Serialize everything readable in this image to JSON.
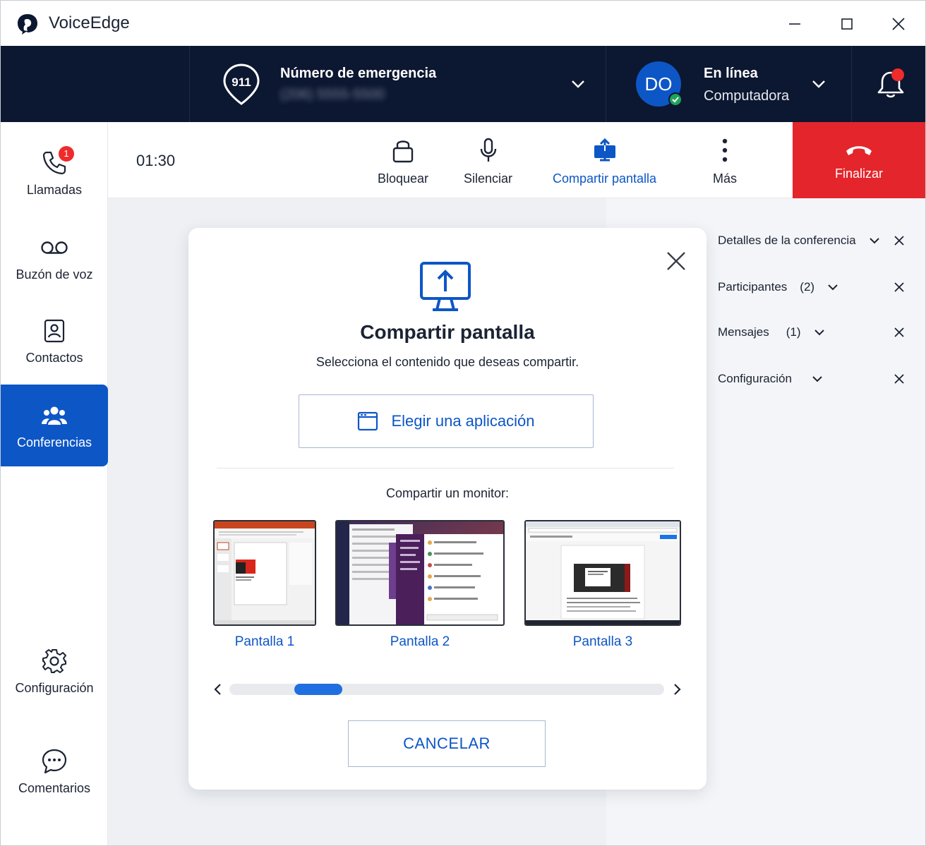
{
  "app": {
    "title": "VoiceEdge",
    "window_controls": [
      "minimize-icon",
      "maximize-icon",
      "close-icon"
    ]
  },
  "header": {
    "emergency": {
      "badge": "911",
      "title": "Número de emergencia",
      "number": "(206) 5555-5500"
    },
    "presence": {
      "initials": "DO",
      "status": "En línea",
      "device": "Computadora"
    },
    "notifications": {
      "has_unread": true
    }
  },
  "sidebar": {
    "items": [
      {
        "label": "Llamadas",
        "icon": "phone-icon",
        "badge": "1"
      },
      {
        "label": "Buzón de voz",
        "icon": "voicemail-icon"
      },
      {
        "label": "Contactos",
        "icon": "contact-card-icon"
      },
      {
        "label": "Conferencias",
        "icon": "group-icon",
        "active": true
      },
      {
        "label": "Configuración",
        "icon": "gear-icon"
      },
      {
        "label": "Comentarios",
        "icon": "chat-bubble-icon"
      }
    ]
  },
  "toolbar": {
    "timer": "01:30",
    "actions": [
      {
        "label": "Bloquear",
        "icon": "lock-icon"
      },
      {
        "label": "Silenciar",
        "icon": "microphone-icon"
      },
      {
        "label": "Compartir pantalla",
        "icon": "share-screen-icon",
        "active": true
      },
      {
        "label": "Más",
        "icon": "more-vertical-icon"
      }
    ],
    "end_call": {
      "label": "Finalizar",
      "icon": "hangup-icon"
    }
  },
  "right_panel": {
    "items": [
      {
        "label": "Detalles de la conferencia",
        "count": ""
      },
      {
        "label": "Participantes",
        "count": "(2)"
      },
      {
        "label": "Mensajes",
        "count": "(1)"
      },
      {
        "label": "Configuración",
        "count": ""
      }
    ]
  },
  "modal": {
    "title": "Compartir pantalla",
    "subtitle": "Selecciona el contenido que deseas compartir.",
    "choose_app_label": "Elegir una aplicación",
    "monitor_label": "Compartir un monitor:",
    "monitors": [
      {
        "label": "Pantalla 1"
      },
      {
        "label": "Pantalla 2"
      },
      {
        "label": "Pantalla 3"
      }
    ],
    "cancel_label": "CANCELAR"
  },
  "colors": {
    "accent": "#0d56c6",
    "header_bg": "#0c1731",
    "end_call": "#e4252b",
    "badge": "#ef2b2b",
    "online": "#1fa35a"
  }
}
